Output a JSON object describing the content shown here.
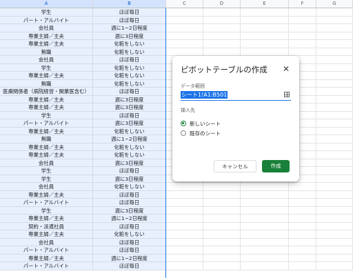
{
  "columns": [
    "A",
    "B",
    "C",
    "D",
    "E",
    "F",
    "G"
  ],
  "rows": [
    [
      "学生",
      "ほぼ毎日"
    ],
    [
      "パート・アルバイト",
      "ほぼ毎日"
    ],
    [
      "会社員",
      "週に1~2日程度"
    ],
    [
      "専業主婦／主夫",
      "週に3日程度"
    ],
    [
      "専業主婦／主夫",
      "化粧をしない"
    ],
    [
      "無職",
      "化粧をしない"
    ],
    [
      "会社員",
      "ほぼ毎日"
    ],
    [
      "学生",
      "化粧をしない"
    ],
    [
      "専業主婦／主夫",
      "化粧をしない"
    ],
    [
      "無職",
      "化粧をしない"
    ],
    [
      "医療関係者（病院経営・開業医含む）",
      "ほぼ毎日"
    ],
    [
      "専業主婦／主夫",
      "週に3日程度"
    ],
    [
      "専業主婦／主夫",
      "週に3日程度"
    ],
    [
      "学生",
      "ほぼ毎日"
    ],
    [
      "パート・アルバイト",
      "週に3日程度"
    ],
    [
      "専業主婦／主夫",
      "化粧をしない"
    ],
    [
      "無職",
      "週に1~2日程度"
    ],
    [
      "専業主婦／主夫",
      "化粧をしない"
    ],
    [
      "専業主婦／主夫",
      "化粧をしない"
    ],
    [
      "会社員",
      "週に3日程度"
    ],
    [
      "学生",
      "ほぼ毎日"
    ],
    [
      "学生",
      "週に3日程度"
    ],
    [
      "会社員",
      "化粧をしない"
    ],
    [
      "専業主婦／主夫",
      "ほぼ毎日"
    ],
    [
      "パート・アルバイト",
      "ほぼ毎日"
    ],
    [
      "学生",
      "週に3日程度"
    ],
    [
      "専業主婦／主夫",
      "週に1~2日程度"
    ],
    [
      "契約・派遣社員",
      "ほぼ毎日"
    ],
    [
      "専業主婦／主夫",
      "化粧をしない"
    ],
    [
      "会社員",
      "ほぼ毎日"
    ],
    [
      "パート・アルバイト",
      "ほぼ毎日"
    ],
    [
      "専業主婦／主夫",
      "週に1~2日程度"
    ],
    [
      "パート・アルバイト",
      "ほぼ毎日"
    ]
  ],
  "dialog": {
    "title": "ピボットテーブルの作成",
    "close": "✕",
    "range_label": "データ範囲",
    "range_value": "シート1!A1:B501",
    "dest_label": "挿入先",
    "option_new": "新しいシート",
    "option_existing": "既存のシート",
    "cancel": "キャンセル",
    "create": "作成"
  },
  "colors": {
    "accent": "#188038",
    "selection": "#e8f0fe"
  }
}
